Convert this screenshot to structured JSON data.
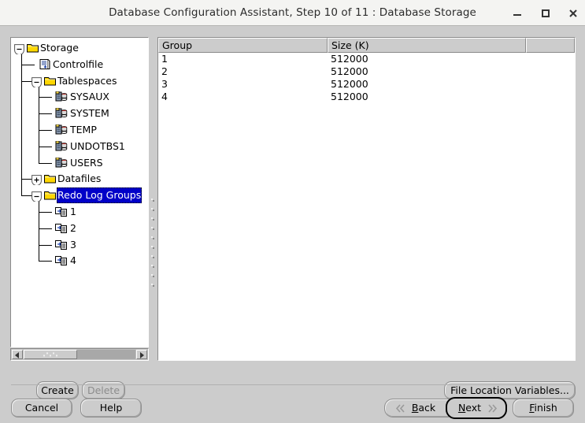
{
  "window": {
    "title": "Database Configuration Assistant, Step 10 of 11 : Database Storage",
    "controls": {
      "minimize": "minimize-icon",
      "maximize": "maximize-icon",
      "close": "close-icon"
    }
  },
  "tree": {
    "nodes": [
      {
        "label": "Storage",
        "depth": 0,
        "icon": "folder-icon",
        "handle": "collapse-minus-icon",
        "selected": false
      },
      {
        "label": "Controlfile",
        "depth": 1,
        "icon": "controlfile-icon",
        "handle": "none",
        "selected": false
      },
      {
        "label": "Tablespaces",
        "depth": 1,
        "icon": "folder-icon",
        "handle": "collapse-minus-icon",
        "selected": false
      },
      {
        "label": "SYSAUX",
        "depth": 2,
        "icon": "tablespace-icon",
        "handle": "none",
        "selected": false
      },
      {
        "label": "SYSTEM",
        "depth": 2,
        "icon": "tablespace-icon",
        "handle": "none",
        "selected": false
      },
      {
        "label": "TEMP",
        "depth": 2,
        "icon": "tablespace-icon",
        "handle": "none",
        "selected": false
      },
      {
        "label": "UNDOTBS1",
        "depth": 2,
        "icon": "tablespace-icon",
        "handle": "none",
        "selected": false
      },
      {
        "label": "USERS",
        "depth": 2,
        "icon": "tablespace-icon",
        "handle": "none",
        "selected": false
      },
      {
        "label": "Datafiles",
        "depth": 1,
        "icon": "folder-icon",
        "handle": "expand-plus-icon",
        "selected": false
      },
      {
        "label": "Redo Log Groups",
        "depth": 1,
        "icon": "folder-icon",
        "handle": "collapse-minus-icon",
        "selected": true
      },
      {
        "label": "1",
        "depth": 2,
        "icon": "redolog-group-icon",
        "handle": "none",
        "selected": false
      },
      {
        "label": "2",
        "depth": 2,
        "icon": "redolog-group-icon",
        "handle": "none",
        "selected": false
      },
      {
        "label": "3",
        "depth": 2,
        "icon": "redolog-group-icon",
        "handle": "none",
        "selected": false
      },
      {
        "label": "4",
        "depth": 2,
        "icon": "redolog-group-icon",
        "handle": "none",
        "selected": false
      }
    ],
    "selection_color": "#0000c8",
    "scrollbar": {
      "left_arrow": "scroll-left-icon",
      "right_arrow": "scroll-right-icon",
      "thumb_position_percent": 0
    }
  },
  "table": {
    "columns": [
      "Group",
      "Size (K)",
      ""
    ],
    "rows": [
      {
        "group": "1",
        "size": "512000",
        "extra": ""
      },
      {
        "group": "2",
        "size": "512000",
        "extra": ""
      },
      {
        "group": "3",
        "size": "512000",
        "extra": ""
      },
      {
        "group": "4",
        "size": "512000",
        "extra": ""
      }
    ]
  },
  "actions": {
    "create": "Create",
    "delete": "Delete",
    "delete_enabled": false,
    "file_location_variables": "File Location Variables..."
  },
  "navigation": {
    "cancel": "Cancel",
    "help": "Help",
    "back": "Back",
    "back_mnemonic": "B",
    "next": "Next",
    "next_mnemonic": "N",
    "finish": "Finish",
    "finish_mnemonic": "F",
    "back_icon": "double-chevron-left-icon",
    "next_icon": "double-chevron-right-icon",
    "focused_button": "Next"
  },
  "colors": {
    "background": "#cccccc",
    "panel": "#ffffff",
    "titlebar": "#f4f4f2",
    "selection": "#0000c8"
  }
}
